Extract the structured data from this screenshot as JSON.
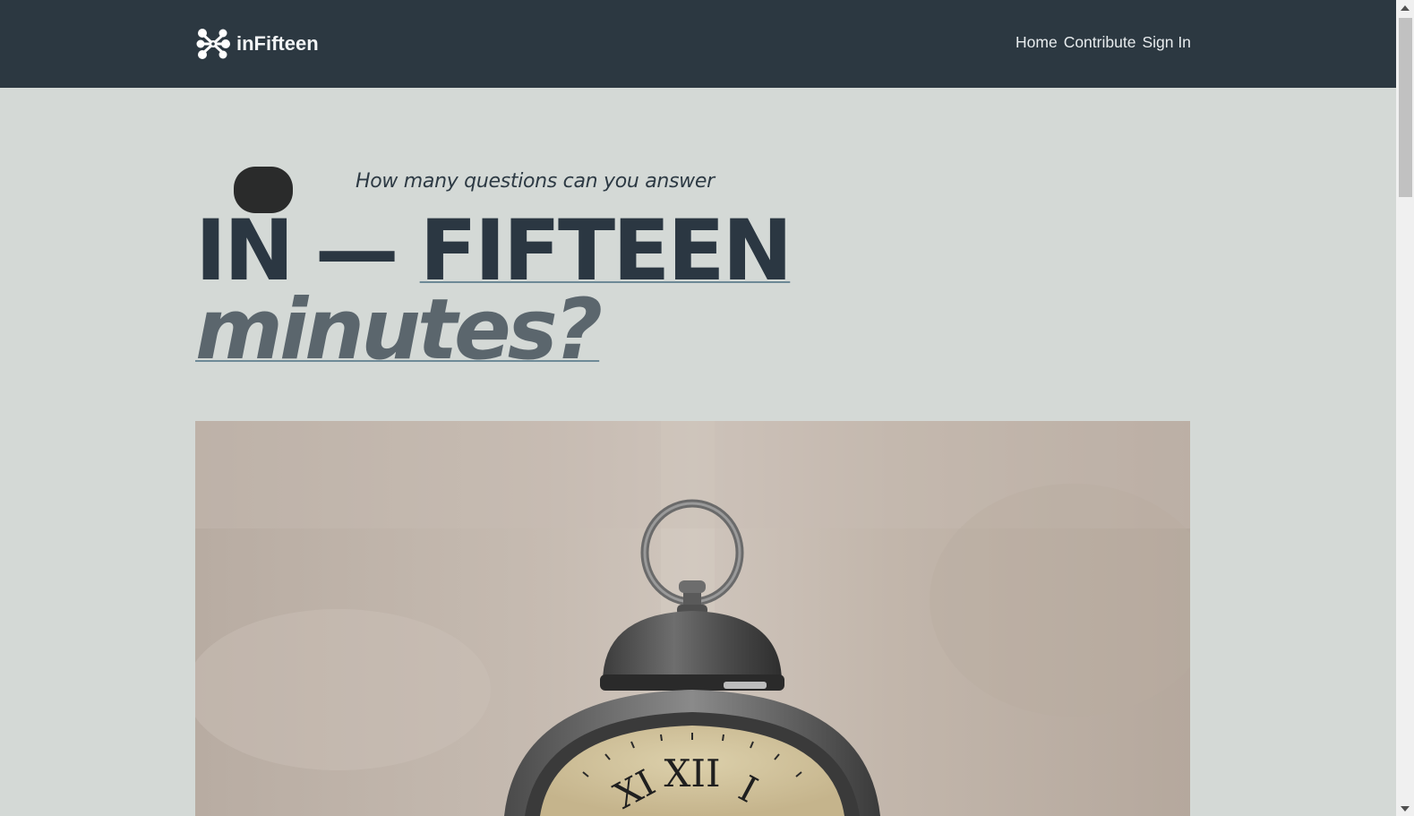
{
  "navbar": {
    "brand_name": "inFifteen",
    "logo_icon": "molecule-icon",
    "links": [
      {
        "label": "Home"
      },
      {
        "label": "Contribute"
      },
      {
        "label": "Sign In"
      }
    ]
  },
  "hero": {
    "tagline": "How many questions can you answer",
    "headline_in": "IN",
    "headline_dash": "—",
    "headline_fifteen": "FIFTEEN",
    "subheadline": "minutes?",
    "image_subject": "alarm-clock-image",
    "clock_numerals": [
      "XI",
      "XII",
      "I"
    ]
  },
  "colors": {
    "navbar_bg": "#2c3841",
    "page_bg": "#d4d9d6",
    "headline": "#2b3742",
    "subheadline": "#5b666d",
    "underline": "#6e8a97"
  }
}
